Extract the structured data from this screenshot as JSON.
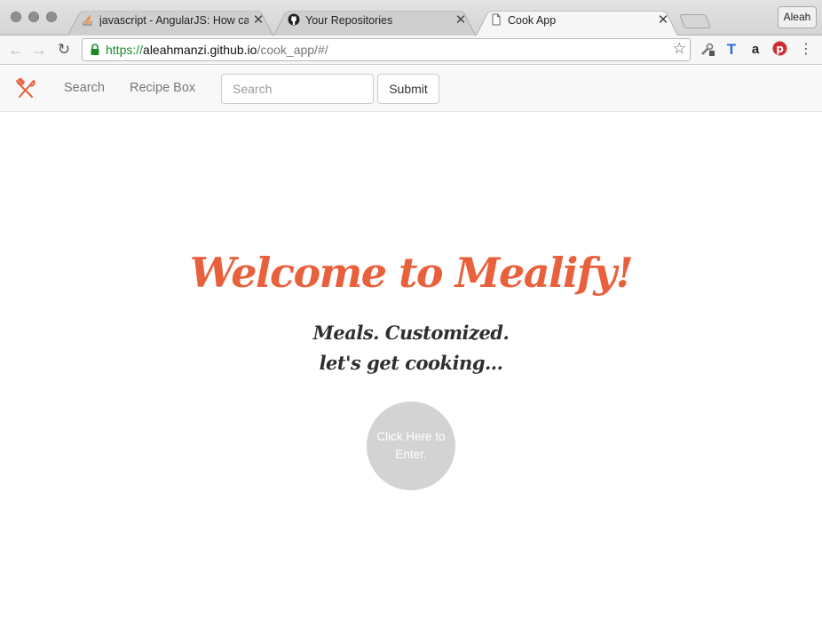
{
  "browser": {
    "tabs": [
      {
        "title": "javascript - AngularJS: How ca",
        "icon": "stackoverflow-icon",
        "active": false
      },
      {
        "title": "Your Repositories",
        "icon": "github-icon",
        "active": false
      },
      {
        "title": "Cook App",
        "icon": "page-icon",
        "active": true
      }
    ],
    "close_glyph": "✕",
    "profile_label": "Aleah",
    "url": {
      "scheme": "https://",
      "host": "aleahmanzi.github.io",
      "path": "/cook_app/#/"
    }
  },
  "app": {
    "nav": {
      "links": [
        "Search",
        "Recipe Box"
      ],
      "search_placeholder": "Search",
      "submit_label": "Submit"
    },
    "hero": {
      "title": "Welcome to Mealify!",
      "line1": "Meals. Customized.",
      "line2": "let's get cooking...",
      "enter_label": "Click Here to Enter."
    },
    "colors": {
      "brand": "#e8603c",
      "text_dark": "#2f2f2f",
      "enter_button": "#d3d3d3"
    }
  }
}
